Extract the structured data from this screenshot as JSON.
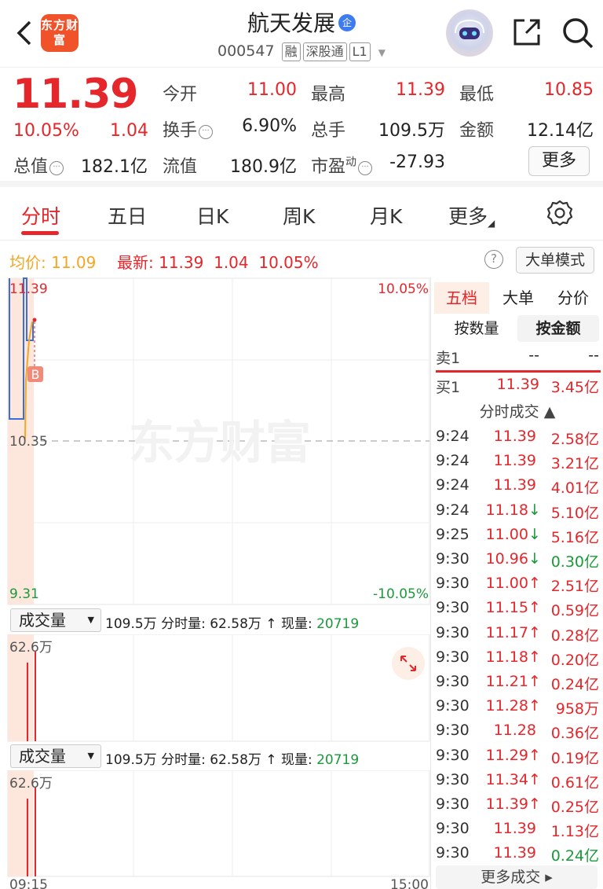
{
  "header": {
    "logo_text": "东方财富",
    "stock_name": "航天发展",
    "name_badge": "企",
    "stock_code": "000547",
    "tags": [
      "融",
      "深股通",
      "L1"
    ]
  },
  "quote": {
    "price": "11.39",
    "change_pct": "10.05%",
    "change_val": "1.04",
    "open_label": "今开",
    "open": "11.00",
    "high_label": "最高",
    "high": "11.39",
    "low_label": "最低",
    "low": "10.85",
    "turnover_label": "换手",
    "turnover": "6.90%",
    "volume_label": "总手",
    "volume": "109.5万",
    "amount_label": "金额",
    "amount": "12.14亿",
    "mktcap_label": "总值",
    "mktcap": "182.1亿",
    "float_label": "流值",
    "float": "180.9亿",
    "pe_label": "市盈",
    "pe_sup": "动",
    "pe": "-27.93",
    "more_label": "更多"
  },
  "tabs": [
    "分时",
    "五日",
    "日K",
    "周K",
    "月K",
    "更多"
  ],
  "avg_bar": {
    "avg_label": "均价:",
    "avg": "11.09",
    "latest_label": "最新:",
    "latest": "11.39",
    "latest_chg": "1.04",
    "latest_pct": "10.05%",
    "help": "?",
    "big_mode": "大单模式"
  },
  "chart": {
    "watermark": "东方财富",
    "top_price": "11.39",
    "top_pct": "10.05%",
    "mid_price": "10.35",
    "bottom_price": "9.31",
    "bottom_pct": "-10.05%",
    "marker": "B",
    "time_start": "09:15",
    "time_end": "15:00"
  },
  "volume": {
    "select_label": "成交量",
    "total": "109.5万",
    "period_label": "分时量:",
    "period": "62.58万",
    "arrow": "↑",
    "now_label": "现量:",
    "now": "20719",
    "axis_max": "62.6万"
  },
  "colors": {
    "red": "#e5262b",
    "green": "#1a9a3a",
    "blue": "#3b6fd6",
    "orange": "#f5a623"
  },
  "right_panel": {
    "tabs": [
      "五档",
      "大单",
      "分价"
    ],
    "segments": [
      "按数量",
      "按金额"
    ],
    "sell1": {
      "label": "卖1",
      "price": "--",
      "amount": "--"
    },
    "buy1": {
      "label": "买1",
      "price": "11.39",
      "amount": "3.45亿"
    },
    "trades_title": "分时成交 ▲",
    "trades": [
      {
        "time": "9:24",
        "price": "11.39",
        "arrow": "",
        "amount": "2.58亿",
        "pc": "red",
        "ac": "red"
      },
      {
        "time": "9:24",
        "price": "11.39",
        "arrow": "",
        "amount": "3.21亿",
        "pc": "red",
        "ac": "red"
      },
      {
        "time": "9:24",
        "price": "11.39",
        "arrow": "",
        "amount": "4.01亿",
        "pc": "red",
        "ac": "red"
      },
      {
        "time": "9:24",
        "price": "11.18",
        "arrow": "↓",
        "amount": "5.10亿",
        "pc": "red",
        "ac": "red"
      },
      {
        "time": "9:25",
        "price": "11.00",
        "arrow": "↓",
        "amount": "5.16亿",
        "pc": "red",
        "ac": "red"
      },
      {
        "time": "9:30",
        "price": "10.96",
        "arrow": "↓",
        "amount": "0.30亿",
        "pc": "red",
        "ac": "green"
      },
      {
        "time": "9:30",
        "price": "11.00",
        "arrow": "↑",
        "amount": "2.51亿",
        "pc": "red",
        "ac": "red"
      },
      {
        "time": "9:30",
        "price": "11.15",
        "arrow": "↑",
        "amount": "0.59亿",
        "pc": "red",
        "ac": "red"
      },
      {
        "time": "9:30",
        "price": "11.17",
        "arrow": "↑",
        "amount": "0.28亿",
        "pc": "red",
        "ac": "red"
      },
      {
        "time": "9:30",
        "price": "11.18",
        "arrow": "↑",
        "amount": "0.20亿",
        "pc": "red",
        "ac": "red"
      },
      {
        "time": "9:30",
        "price": "11.21",
        "arrow": "↑",
        "amount": "0.24亿",
        "pc": "red",
        "ac": "red"
      },
      {
        "time": "9:30",
        "price": "11.28",
        "arrow": "↑",
        "amount": "958万",
        "pc": "red",
        "ac": "red"
      },
      {
        "time": "9:30",
        "price": "11.28",
        "arrow": "",
        "amount": "0.36亿",
        "pc": "red",
        "ac": "red"
      },
      {
        "time": "9:30",
        "price": "11.29",
        "arrow": "↑",
        "amount": "0.19亿",
        "pc": "red",
        "ac": "red"
      },
      {
        "time": "9:30",
        "price": "11.34",
        "arrow": "↑",
        "amount": "0.61亿",
        "pc": "red",
        "ac": "red"
      },
      {
        "time": "9:30",
        "price": "11.39",
        "arrow": "↑",
        "amount": "0.25亿",
        "pc": "red",
        "ac": "red"
      },
      {
        "time": "9:30",
        "price": "11.39",
        "arrow": "",
        "amount": "1.13亿",
        "pc": "red",
        "ac": "red"
      },
      {
        "time": "9:30",
        "price": "11.39",
        "arrow": "",
        "amount": "0.24亿",
        "pc": "red",
        "ac": "green"
      }
    ],
    "more_trades": "更多成交 ▸"
  }
}
